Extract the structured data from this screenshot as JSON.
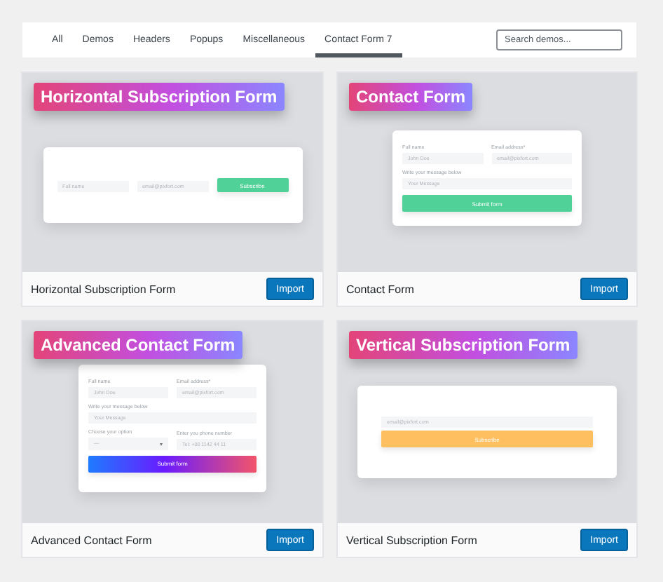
{
  "tabs": [
    {
      "label": "All",
      "selected": false
    },
    {
      "label": "Demos",
      "selected": false
    },
    {
      "label": "Headers",
      "selected": false
    },
    {
      "label": "Popups",
      "selected": false
    },
    {
      "label": "Miscellaneous",
      "selected": false
    },
    {
      "label": "Contact Form 7",
      "selected": true
    }
  ],
  "search": {
    "placeholder": "Search demos..."
  },
  "cards": [
    {
      "kind": "horizontal",
      "banner": "Horizontal Subscription Form",
      "title": "Horizontal Subscription Form",
      "button": "Import",
      "preview": {
        "fields": [
          {
            "placeholder": "Full name"
          },
          {
            "placeholder": "email@pixfort.com"
          }
        ],
        "submit": "Subscribe"
      }
    },
    {
      "kind": "contact",
      "banner": "Contact Form",
      "title": "Contact Form",
      "button": "Import",
      "preview": {
        "fields": [
          {
            "label": "Full name",
            "placeholder": "John Doe"
          },
          {
            "label": "Email address*",
            "placeholder": "email@pixfort.com"
          }
        ],
        "message": {
          "label": "Write your message below",
          "placeholder": "Your Message"
        },
        "submit": "Submit form"
      }
    },
    {
      "kind": "advanced",
      "banner": "Advanced Contact Form",
      "title": "Advanced Contact Form",
      "button": "Import",
      "preview": {
        "fields": [
          {
            "label": "Full name",
            "placeholder": "John Doe"
          },
          {
            "label": "Email address*",
            "placeholder": "email@pixfort.com"
          }
        ],
        "message": {
          "label": "Write your message below",
          "placeholder": "Your Message"
        },
        "extras": [
          {
            "label": "Choose your option",
            "value": "—",
            "caret": "▾"
          },
          {
            "label": "Enter you phone number",
            "placeholder": "Tel: +00 1142 44 11"
          }
        ],
        "submit": "Submit form"
      }
    },
    {
      "kind": "vertical",
      "banner": "Vertical Subscription Form",
      "title": "Vertical Subscription Form",
      "button": "Import",
      "preview": {
        "fields": [
          {
            "placeholder": "email@pixfort.com"
          }
        ],
        "submit": "Subscribe"
      }
    }
  ]
}
